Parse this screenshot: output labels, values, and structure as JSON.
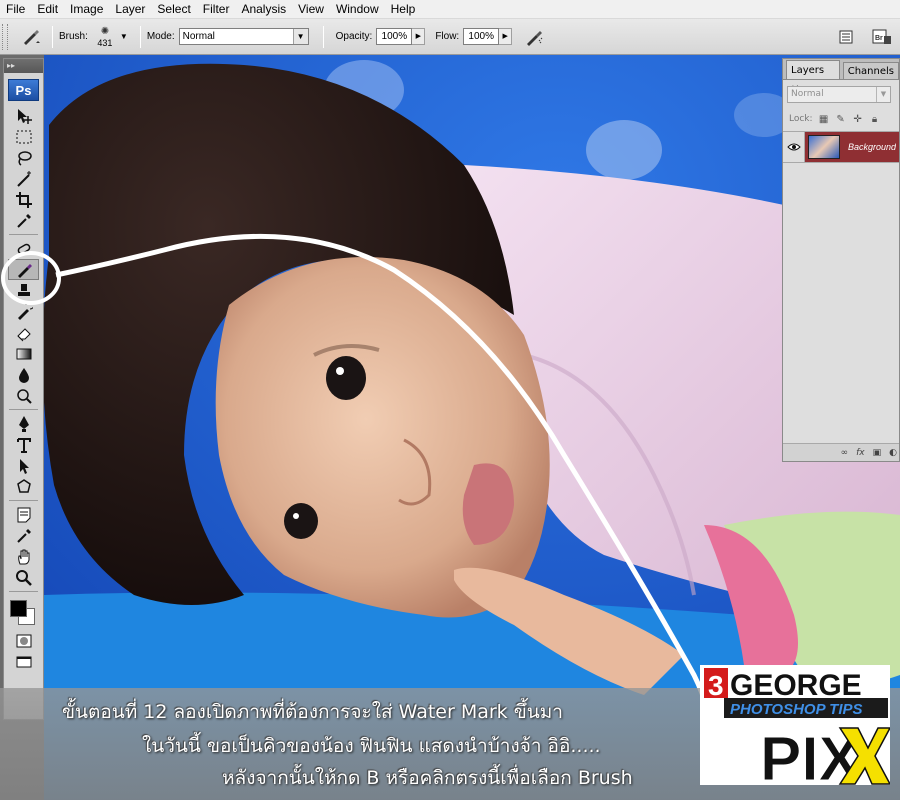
{
  "menu": [
    "File",
    "Edit",
    "Image",
    "Layer",
    "Select",
    "Filter",
    "Analysis",
    "View",
    "Window",
    "Help"
  ],
  "options_bar": {
    "brush_label": "Brush:",
    "brush_size": "431",
    "mode_label": "Mode:",
    "mode_value": "Normal",
    "opacity_label": "Opacity:",
    "opacity_value": "100%",
    "flow_label": "Flow:",
    "flow_value": "100%"
  },
  "tools": {
    "logo": "Ps",
    "selected": "brush-tool"
  },
  "layers_panel": {
    "tabs": [
      "Layers",
      "Channels"
    ],
    "blend_mode": "Normal",
    "lock_label": "Lock:",
    "layer_name": "Background"
  },
  "caption": {
    "line1": "ขั้นตอนที่ 12 ลองเปิดภาพที่ต้องการจะใส่ Water Mark ขึ้นมา",
    "line2": "ในวันนี้ ขอเป็นคิวของน้อง ฟินฟิน แสดงนำบ้างจ้า อิอิ.....",
    "line3": "หลังจากนั้นให้กด B  หรือคลิกตรงนี้เพื่อเลือก  Brush"
  },
  "logo": {
    "prefix": "3",
    "name": "GEORGE",
    "sub": "PHOTOSHOP TIPS",
    "big": "PIX"
  }
}
